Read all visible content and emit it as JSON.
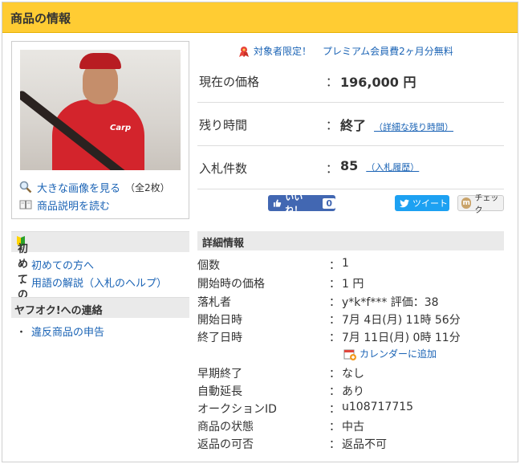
{
  "header": {
    "title": "商品の情報"
  },
  "image_area": {
    "photo_logo": "Carp",
    "enlarge_link": "大きな画像を見る",
    "enlarge_count": "（全2枚）",
    "description_link": "商品説明を読む"
  },
  "promo": {
    "label": "対象者限定！",
    "text": "プレミアム会員費2ヶ月分無料"
  },
  "stats": {
    "price": {
      "label": "現在の価格",
      "value": "196,000 円"
    },
    "time": {
      "label": "残り時間",
      "value": "終了",
      "sub": "（詳細な残り時間）"
    },
    "bids": {
      "label": "入札件数",
      "value": "85",
      "sub": "（入札履歴）"
    },
    "colon": "："
  },
  "social": {
    "like_label": "いいね！",
    "like_count": "0",
    "tweet_label": "ツイート",
    "check_label": "チェック"
  },
  "sidebar": {
    "beginners": {
      "title": "初めての方",
      "items": [
        "初めての方へ",
        "用語の解説（入札のヘルプ）"
      ]
    },
    "contact": {
      "title": "ヤフオク!への連絡",
      "items": [
        "違反商品の申告"
      ]
    },
    "bullet": "・"
  },
  "details": {
    "title": "詳細情報",
    "rows": [
      {
        "key": "個数",
        "value": "1"
      },
      {
        "key": "開始時の価格",
        "value": "1 円"
      },
      {
        "key": "落札者",
        "value": "y*k*f*** 評価：38"
      },
      {
        "key": "開始日時",
        "value": "7月 4日(月) 11時 56分"
      },
      {
        "key": "終了日時",
        "value": "7月 11日(月) 0時 11分"
      },
      {
        "key": "早期終了",
        "value": "なし"
      },
      {
        "key": "自動延長",
        "value": "あり"
      },
      {
        "key": "オークションID",
        "value": "u108717715"
      },
      {
        "key": "商品の状態",
        "value": "中古"
      },
      {
        "key": "返品の可否",
        "value": "返品不可"
      }
    ],
    "calendar_link": "カレンダーに追加"
  },
  "colors": {
    "header_bg": "#ffcc33",
    "link": "#1a63b5",
    "like_bg": "#4267b2",
    "tweet_bg": "#1da1f2"
  }
}
